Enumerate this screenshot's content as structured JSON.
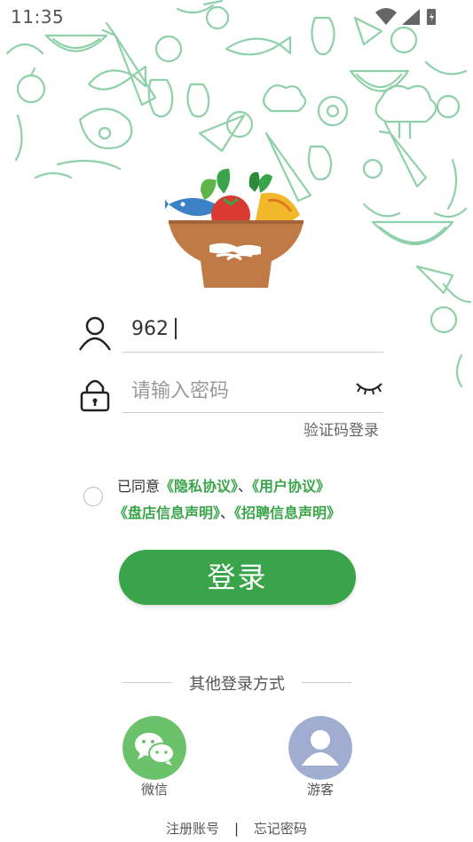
{
  "status_bar": {
    "time": "11:35"
  },
  "login": {
    "username_value": "962",
    "password_placeholder": "请输入密码",
    "sms_login_label": "验证码登录",
    "login_button_label": "登录"
  },
  "agreement": {
    "prefix": "已同意",
    "privacy": "《隐私协议》",
    "sep1": "、",
    "user": "《用户协议》",
    "store": "《盘店信息声明》",
    "sep2": "、",
    "recruit": "《招聘信息声明》"
  },
  "other_login": {
    "title": "其他登录方式",
    "wechat_label": "微信",
    "guest_label": "游客"
  },
  "footer": {
    "register_label": "注册账号",
    "separator": "|",
    "forgot_label": "忘记密码"
  },
  "colors": {
    "accent": "#3aa44a",
    "wechat": "#6cc16b",
    "guest": "#a1add0",
    "doodle": "#8ed0a8"
  }
}
